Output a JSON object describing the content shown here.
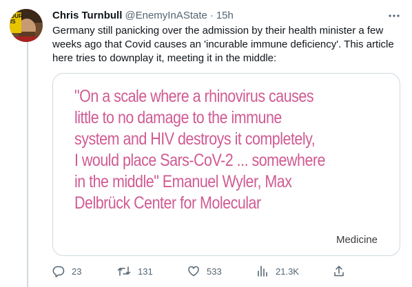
{
  "tweet": {
    "author_name": "Chris Turnbull",
    "handle": "@EnemyInAState",
    "separator": "·",
    "timestamp": "15h",
    "avatar_sign_text": "OUR IS",
    "body_lines": [
      "Germany still panicking over the admission by their health minister a few",
      "weeks ago that Covid causes an 'incurable immune deficiency'. This article",
      "here tries to downplay it, meeting it in the middle:"
    ],
    "card": {
      "quote_lines": [
        "\"On a scale where a rhinovirus causes",
        "little to no damage to the immune",
        "system and HIV destroys it completely,",
        "I would place Sars-CoV-2 ... somewhere",
        "in the middle\" Emanuel Wyler, Max",
        "Delbrück Center for Molecular"
      ],
      "label": "Medicine"
    },
    "actions": {
      "reply_count": "23",
      "retweet_count": "131",
      "like_count": "533",
      "views_count": "21.3K"
    }
  },
  "icons": {
    "more": "more-dots-icon",
    "reply": "reply-bubble-icon",
    "retweet": "retweet-icon",
    "like": "heart-icon",
    "views": "views-bar-chart-icon",
    "share": "share-upload-icon"
  },
  "colors": {
    "quote_text": "#d05b93",
    "secondary_text": "#536471",
    "primary_text": "#0f1419",
    "border": "#cfd9de"
  }
}
